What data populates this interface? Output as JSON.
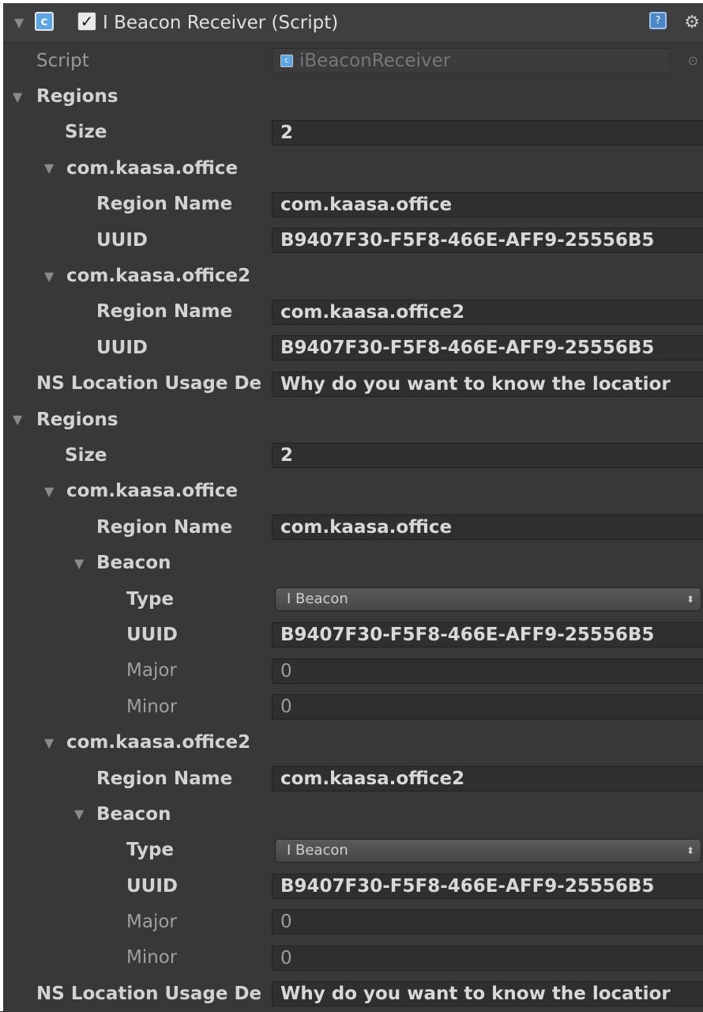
{
  "component": {
    "title": "I Beacon Receiver (Script)",
    "enabled_mark": "✓",
    "icon": "script-icon",
    "help_icon": "help-book-icon",
    "gear_icon": "gear-icon",
    "script_label": "Script",
    "script_value": "iBeaconReceiver"
  },
  "section1": {
    "label": "Regions",
    "size_label": "Size",
    "size_value": "2",
    "regions": [
      {
        "label": "com.kaasa.office",
        "name_label": "Region Name",
        "name_value": "com.kaasa.office",
        "uuid_label": "UUID",
        "uuid_value": "B9407F30-F5F8-466E-AFF9-25556B5"
      },
      {
        "label": "com.kaasa.office2",
        "name_label": "Region Name",
        "name_value": "com.kaasa.office2",
        "uuid_label": "UUID",
        "uuid_value": "B9407F30-F5F8-466E-AFF9-25556B5"
      }
    ],
    "ns_label": "NS Location Usage De",
    "ns_value": "Why do you want to know the locatior"
  },
  "section2": {
    "label": "Regions",
    "size_label": "Size",
    "size_value": "2",
    "regions": [
      {
        "label": "com.kaasa.office",
        "name_label": "Region Name",
        "name_value": "com.kaasa.office",
        "beacon_label": "Beacon",
        "type_label": "Type",
        "type_value": "I Beacon",
        "uuid_label": "UUID",
        "uuid_value": "B9407F30-F5F8-466E-AFF9-25556B5",
        "major_label": "Major",
        "major_value": "0",
        "minor_label": "Minor",
        "minor_value": "0"
      },
      {
        "label": "com.kaasa.office2",
        "name_label": "Region Name",
        "name_value": "com.kaasa.office2",
        "beacon_label": "Beacon",
        "type_label": "Type",
        "type_value": "I Beacon",
        "uuid_label": "UUID",
        "uuid_value": "B9407F30-F5F8-466E-AFF9-25556B5",
        "major_label": "Major",
        "major_value": "0",
        "minor_label": "Minor",
        "minor_value": "0"
      }
    ],
    "ns_label": "NS Location Usage De",
    "ns_value": "Why do you want to know the locatior"
  }
}
